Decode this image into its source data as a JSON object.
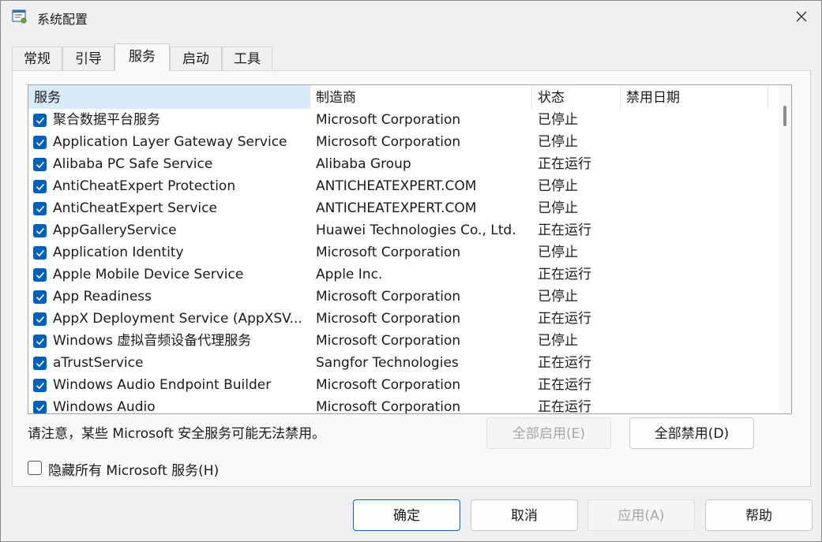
{
  "window": {
    "title": "系统配置",
    "close_glyph": "✕"
  },
  "tabs": [
    {
      "label": "常规",
      "active": false
    },
    {
      "label": "引导",
      "active": false
    },
    {
      "label": "服务",
      "active": true
    },
    {
      "label": "启动",
      "active": false
    },
    {
      "label": "工具",
      "active": false
    }
  ],
  "table": {
    "headers": {
      "service": "服务",
      "manufacturer": "制造商",
      "status": "状态",
      "disabled_date": "禁用日期"
    },
    "rows": [
      {
        "name": "聚合数据平台服务",
        "manufacturer": "Microsoft Corporation",
        "status": "已停止",
        "date": "",
        "checked": true
      },
      {
        "name": "Application Layer Gateway Service",
        "manufacturer": "Microsoft Corporation",
        "status": "已停止",
        "date": "",
        "checked": true
      },
      {
        "name": "Alibaba PC Safe Service",
        "manufacturer": "Alibaba Group",
        "status": "正在运行",
        "date": "",
        "checked": true
      },
      {
        "name": "AntiCheatExpert Protection",
        "manufacturer": "ANTICHEATEXPERT.COM",
        "status": "已停止",
        "date": "",
        "checked": true
      },
      {
        "name": "AntiCheatExpert Service",
        "manufacturer": "ANTICHEATEXPERT.COM",
        "status": "已停止",
        "date": "",
        "checked": true
      },
      {
        "name": "AppGalleryService",
        "manufacturer": "Huawei Technologies Co., Ltd.",
        "status": "正在运行",
        "date": "",
        "checked": true
      },
      {
        "name": "Application Identity",
        "manufacturer": "Microsoft Corporation",
        "status": "已停止",
        "date": "",
        "checked": true
      },
      {
        "name": "Apple Mobile Device Service",
        "manufacturer": "Apple Inc.",
        "status": "正在运行",
        "date": "",
        "checked": true
      },
      {
        "name": "App Readiness",
        "manufacturer": "Microsoft Corporation",
        "status": "已停止",
        "date": "",
        "checked": true
      },
      {
        "name": "AppX Deployment Service (AppXSV...",
        "manufacturer": "Microsoft Corporation",
        "status": "正在运行",
        "date": "",
        "checked": true
      },
      {
        "name": "Windows 虚拟音频设备代理服务",
        "manufacturer": "Microsoft Corporation",
        "status": "已停止",
        "date": "",
        "checked": true
      },
      {
        "name": "aTrustService",
        "manufacturer": "Sangfor Technologies",
        "status": "正在运行",
        "date": "",
        "checked": true
      },
      {
        "name": "Windows Audio Endpoint Builder",
        "manufacturer": "Microsoft Corporation",
        "status": "正在运行",
        "date": "",
        "checked": true
      },
      {
        "name": "Windows Audio",
        "manufacturer": "Microsoft Corporation",
        "status": "正在运行",
        "date": "",
        "checked": true
      }
    ]
  },
  "note": "请注意，某些 Microsoft 安全服务可能无法禁用。",
  "buttons": {
    "enable_all": "全部启用(E)",
    "disable_all": "全部禁用(D)",
    "ok": "确定",
    "cancel": "取消",
    "apply": "应用(A)",
    "help": "帮助"
  },
  "hide_ms": {
    "label": "隐藏所有 Microsoft 服务(H)",
    "checked": false
  },
  "colors": {
    "accent": "#005fb8",
    "header_sorted": "#d9ebf9",
    "disabled_text": "#a6a6a6"
  },
  "icons": {
    "app": "msconfig-icon",
    "close": "close-icon",
    "check": "checkmark-icon"
  }
}
